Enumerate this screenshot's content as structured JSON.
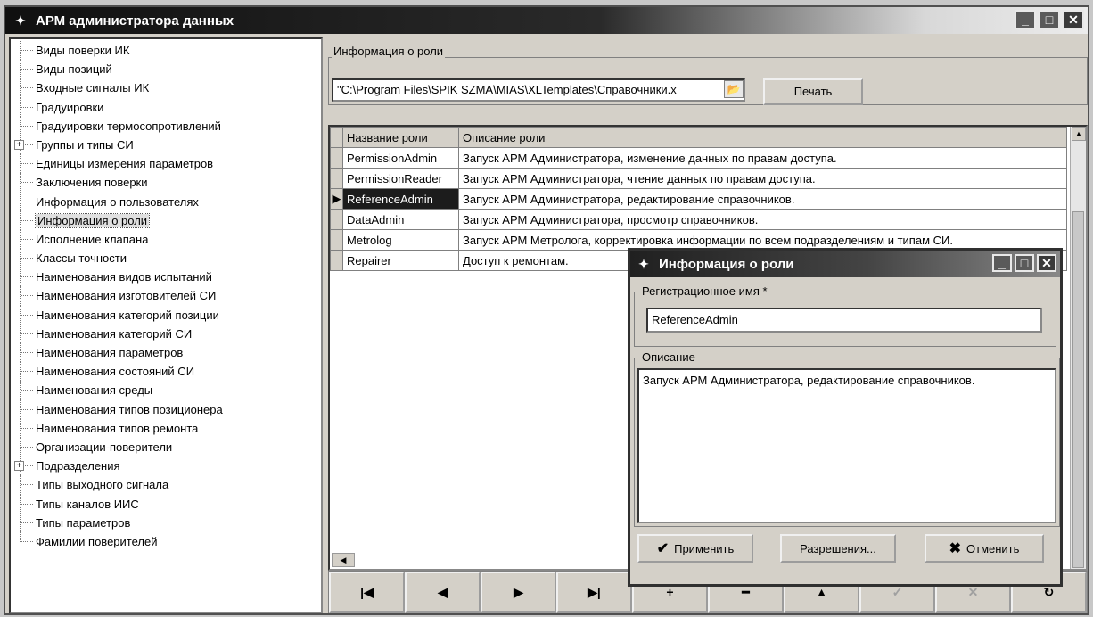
{
  "window": {
    "title": "АРМ администратора данных",
    "controls": {
      "minimize": "_",
      "maximize": "□",
      "close": "✕"
    }
  },
  "tree": {
    "items": [
      {
        "label": "Виды поверки ИК"
      },
      {
        "label": "Виды позиций"
      },
      {
        "label": "Входные сигналы ИК"
      },
      {
        "label": "Градуировки"
      },
      {
        "label": "Градуировки термосопротивлений"
      },
      {
        "label": "Группы и типы СИ",
        "expandable": true
      },
      {
        "label": "Единицы измерения параметров"
      },
      {
        "label": "Заключения поверки"
      },
      {
        "label": "Информация о пользователях"
      },
      {
        "label": "Информация о роли",
        "selected": true
      },
      {
        "label": "Исполнение клапана"
      },
      {
        "label": "Классы точности"
      },
      {
        "label": "Наименования видов испытаний"
      },
      {
        "label": "Наименования изготовителей СИ"
      },
      {
        "label": "Наименования категорий позиции"
      },
      {
        "label": "Наименования категорий СИ"
      },
      {
        "label": "Наименования параметров"
      },
      {
        "label": "Наименования состояний СИ"
      },
      {
        "label": "Наименования среды"
      },
      {
        "label": "Наименования типов позиционера"
      },
      {
        "label": "Наименования типов ремонта"
      },
      {
        "label": "Организации-поверители"
      },
      {
        "label": "Подразделения",
        "expandable": true
      },
      {
        "label": "Типы выходного сигнала"
      },
      {
        "label": "Типы каналов ИИС"
      },
      {
        "label": "Типы параметров"
      },
      {
        "label": "Фамилии поверителей"
      }
    ]
  },
  "main": {
    "group_title": "Информация о роли",
    "template_path": "\"C:\\Program Files\\SPIK SZMA\\MIAS\\XLTemplates\\Справочники.x",
    "print_label": "Печать",
    "grid": {
      "columns": [
        "Название роли",
        "Описание роли"
      ],
      "rows": [
        {
          "name": "PermissionAdmin",
          "description": "Запуск АРМ Администратора, изменение данных по правам доступа."
        },
        {
          "name": "PermissionReader",
          "description": "Запуск АРМ Администратора, чтение данных по правам доступа."
        },
        {
          "name": "ReferenceAdmin",
          "description": "Запуск АРМ Администратора, редактирование справочников.",
          "selected": true
        },
        {
          "name": "DataAdmin",
          "description": "Запуск АРМ Администратора, просмотр справочников."
        },
        {
          "name": "Metrolog",
          "description": "Запуск АРМ Метролога, корректировка информации по всем подразделениям и типам СИ."
        },
        {
          "name": "Repairer",
          "description": " Доступ к ремонтам."
        }
      ]
    },
    "navigator": [
      "first",
      "prior",
      "next",
      "last",
      "insert",
      "delete",
      "edit",
      "post",
      "cancel",
      "refresh"
    ]
  },
  "dialog": {
    "title": "Информация о роли",
    "reg_name_label": "Регистрационное имя *",
    "reg_name_value": "ReferenceAdmin",
    "description_label": "Описание",
    "description_value": "Запуск АРМ Администратора, редактирование справочников.",
    "apply_label": "Применить",
    "permissions_label": "Разрешения...",
    "cancel_label": "Отменить"
  }
}
